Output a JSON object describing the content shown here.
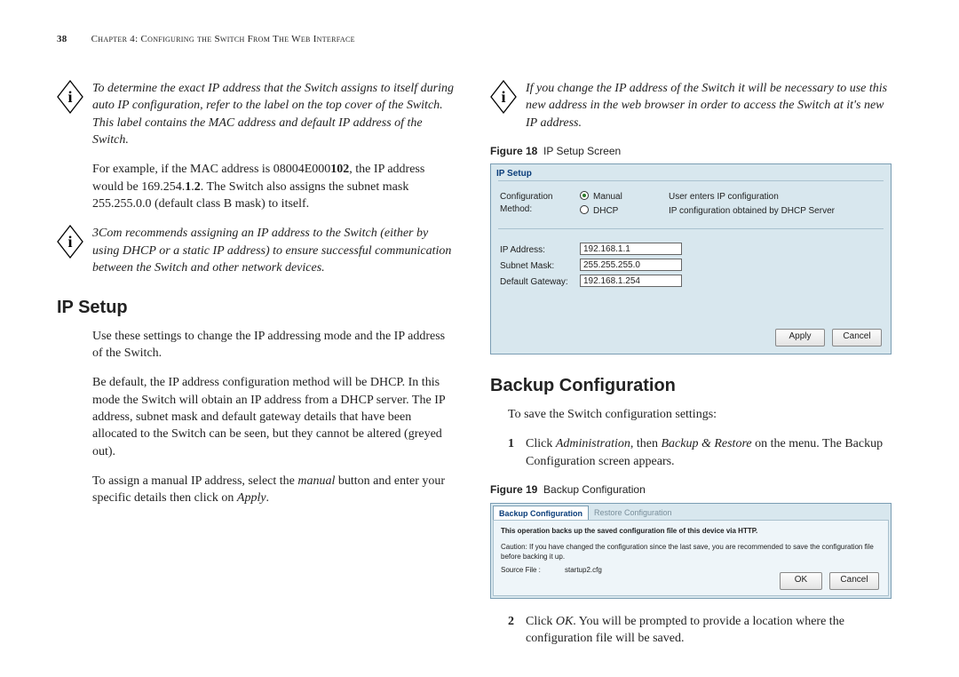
{
  "page_number": "38",
  "chapter_header": "Chapter 4: Configuring the Switch From The Web Interface",
  "left": {
    "note1": "To determine the exact IP address that the Switch assigns to itself during auto IP configuration, refer to the label on the top cover of the Switch. This label contains the MAC address and default IP address of the Switch.",
    "example_pre": "For example, if the MAC address is 08004E000",
    "example_bold1": "102",
    "example_mid": ", the IP address would be 169.254.",
    "example_bold2": "1",
    "example_dot": ".",
    "example_bold3": "2",
    "example_post": ". The Switch also assigns the subnet mask 255.255.0.0 (default class B mask) to itself.",
    "note2": "3Com recommends assigning an IP address to the Switch (either by using DHCP or a static IP address) to ensure successful communication between the Switch and other network devices.",
    "h_ipsetup": "IP Setup",
    "p1": "Use these settings to change the IP addressing mode and the IP address of the Switch.",
    "p2_pre": "Be default, the IP address configuration method will be DHCP. In this mode the Switch will obtain an IP address from a DHCP server. The IP address, subnet mask and default gateway details that have been allocated to the Switch can be seen, but they cannot be altered (greyed out).",
    "p3_pre": "To assign a manual IP address, select the ",
    "p3_em1": "manual",
    "p3_mid": " button and enter your specific details then click on ",
    "p3_em2": "Apply",
    "p3_post": "."
  },
  "right": {
    "note1": "If you change the IP address of the Switch it will be necessary to use this new address in the web browser in order to access the Switch at it's new IP address.",
    "fig18_label": "Figure 18",
    "fig18_title": "IP Setup Screen",
    "ip_panel": {
      "title": "IP Setup",
      "cfg_label": "Configuration Method:",
      "opt_manual": "Manual",
      "opt_dhcp": "DHCP",
      "help_manual": "User enters IP configuration",
      "help_dhcp": "IP configuration obtained by DHCP Server",
      "ip_label": "IP Address:",
      "ip_value": "192.168.1.1",
      "mask_label": "Subnet Mask:",
      "mask_value": "255.255.255.0",
      "gw_label": "Default Gateway:",
      "gw_value": "192.168.1.254",
      "apply": "Apply",
      "cancel": "Cancel"
    },
    "h_backup": "Backup Configuration",
    "bk_intro": "To save the Switch configuration settings:",
    "step1_pre": "Click ",
    "step1_em1": "Administration",
    "step1_mid": ", then ",
    "step1_em2": "Backup & Restore",
    "step1_post": " on the menu. The Backup Configuration screen appears.",
    "fig19_label": "Figure 19",
    "fig19_title": "Backup Configuration",
    "bk_panel": {
      "tab_active": "Backup Configuration",
      "tab_inactive": "Restore Configuration",
      "line1": "This operation backs up the saved configuration file of this device via HTTP.",
      "line2": "Caution: If you have changed the configuration since the last save, you are recommended to save the configuration file before backing it up.",
      "src_label": "Source File :",
      "src_value": "startup2.cfg",
      "ok": "OK",
      "cancel": "Cancel"
    },
    "step2_pre": "Click ",
    "step2_em": "OK",
    "step2_post": ". You will be prompted to provide a location where the configuration file will be saved."
  },
  "step_nums": {
    "s1": "1",
    "s2": "2"
  }
}
